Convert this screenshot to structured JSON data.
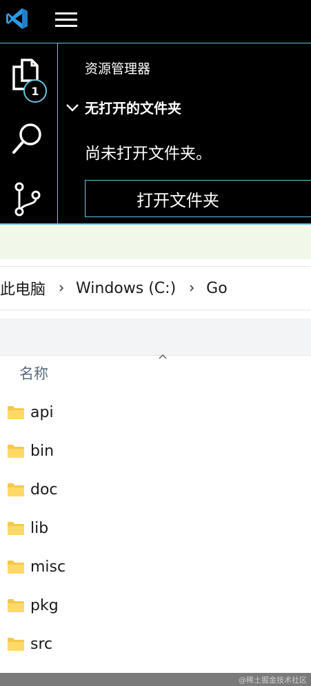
{
  "vscode": {
    "sidebar": {
      "title": "资源管理器",
      "section": "无打开的文件夹",
      "message": "尚未打开文件夹。",
      "open_folder_button": "打开文件夹"
    },
    "activity": {
      "explorer_badge": "1"
    },
    "colors": {
      "border": "#6fc3df",
      "background": "#000000"
    }
  },
  "explorer": {
    "breadcrumb": [
      "此电脑",
      "Windows (C:)",
      "Go"
    ],
    "column_header": "名称",
    "files": [
      "api",
      "bin",
      "doc",
      "lib",
      "misc",
      "pkg",
      "src"
    ],
    "colors": {
      "folder": "#f5c84c",
      "accent_strip": "#f1f8ea"
    }
  },
  "watermark": "@稀土掘金技术社区"
}
